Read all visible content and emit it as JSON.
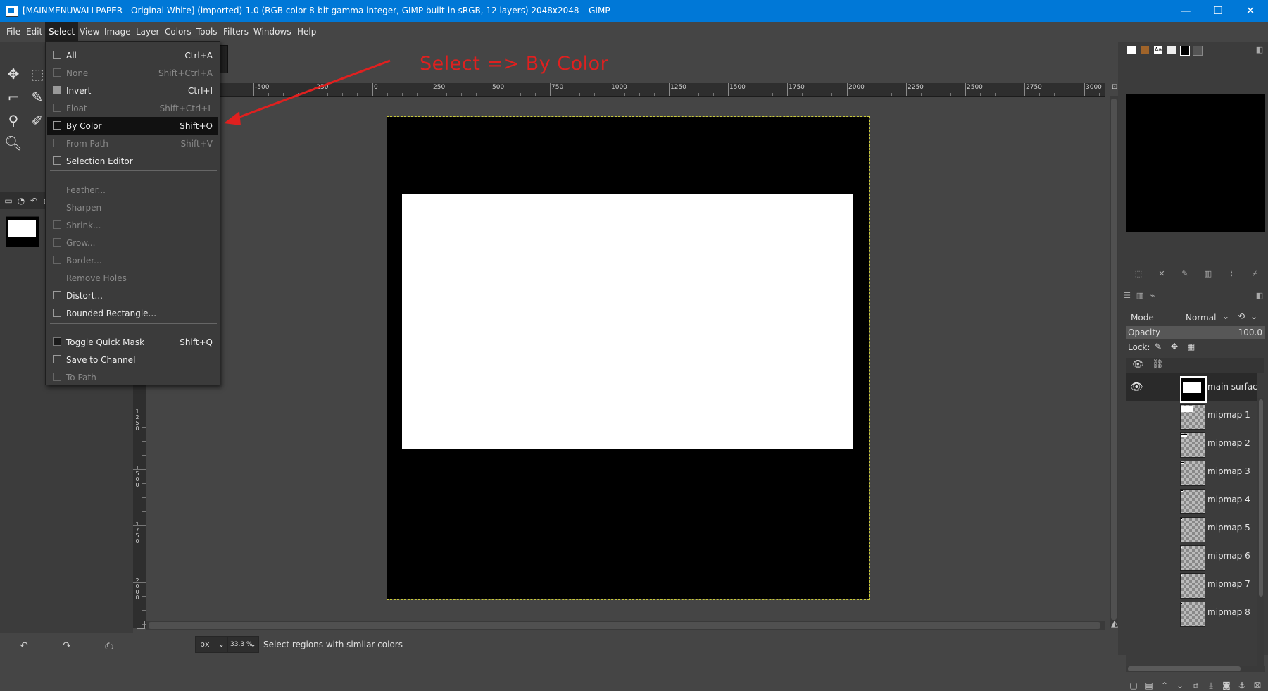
{
  "window": {
    "title": "[MAINMENUWALLPAPER - Original-White] (imported)-1.0 (RGB color 8-bit gamma integer, GIMP built-in sRGB, 12 layers) 2048x2048 – GIMP",
    "minimize": "—",
    "maximize": "☐",
    "close": "✕"
  },
  "menubar": [
    "File",
    "Edit",
    "Select",
    "View",
    "Image",
    "Layer",
    "Colors",
    "Tools",
    "Filters",
    "Windows",
    "Help"
  ],
  "select_menu": {
    "items": [
      {
        "label": "All",
        "accel": "Ctrl+A",
        "enabled": true
      },
      {
        "label": "None",
        "accel": "Shift+Ctrl+A",
        "enabled": false
      },
      {
        "label": "Invert",
        "accel": "Ctrl+I",
        "enabled": true
      },
      {
        "label": "Float",
        "accel": "Shift+Ctrl+L",
        "enabled": false
      },
      {
        "label": "By Color",
        "accel": "Shift+O",
        "enabled": true,
        "highlighted": true
      },
      {
        "label": "From Path",
        "accel": "Shift+V",
        "enabled": false
      },
      {
        "label": "Selection Editor",
        "accel": "",
        "enabled": true
      },
      {
        "label": "Feather...",
        "accel": "",
        "enabled": false
      },
      {
        "label": "Sharpen",
        "accel": "",
        "enabled": false
      },
      {
        "label": "Shrink...",
        "accel": "",
        "enabled": false
      },
      {
        "label": "Grow...",
        "accel": "",
        "enabled": false
      },
      {
        "label": "Border...",
        "accel": "",
        "enabled": false
      },
      {
        "label": "Remove Holes",
        "accel": "",
        "enabled": false
      },
      {
        "label": "Distort...",
        "accel": "",
        "enabled": true
      },
      {
        "label": "Rounded Rectangle...",
        "accel": "",
        "enabled": true
      },
      {
        "label": "Toggle Quick Mask",
        "accel": "Shift+Q",
        "enabled": true
      },
      {
        "label": "Save to Channel",
        "accel": "",
        "enabled": true
      },
      {
        "label": "To Path",
        "accel": "",
        "enabled": false
      }
    ]
  },
  "annotation": {
    "text": "Select => By Color",
    "color": "#e0201f"
  },
  "ruler": {
    "h_labels": [
      "250",
      "-500",
      "-250",
      "0",
      "250",
      "500",
      "750",
      "1000",
      "1250",
      "1500",
      "1750",
      "2000",
      "2250",
      "2500",
      "2750",
      "3000"
    ],
    "v_labels": [
      "1250",
      "1500",
      "1750",
      "2000"
    ]
  },
  "statusbar": {
    "unit": "px",
    "zoom": "33.3 %",
    "message": "Select regions with similar colors"
  },
  "layers_panel": {
    "mode_label": "Mode",
    "mode_value": "Normal",
    "opacity_label": "Opacity",
    "opacity_value": "100.0",
    "lock_label": "Lock:",
    "layers": [
      {
        "name": "main surface",
        "visible": true,
        "selected": true
      },
      {
        "name": "mipmap 1",
        "visible": false
      },
      {
        "name": "mipmap 2",
        "visible": false
      },
      {
        "name": "mipmap 3",
        "visible": false
      },
      {
        "name": "mipmap 4",
        "visible": false
      },
      {
        "name": "mipmap 5",
        "visible": false
      },
      {
        "name": "mipmap 6",
        "visible": false
      },
      {
        "name": "mipmap 7",
        "visible": false
      },
      {
        "name": "mipmap 8",
        "visible": false
      }
    ]
  },
  "colors": {
    "titlebar": "#0078d7",
    "menu_highlight": "#111111",
    "canvas_bg": "#000000",
    "selection_outline": "#c8c83a"
  }
}
